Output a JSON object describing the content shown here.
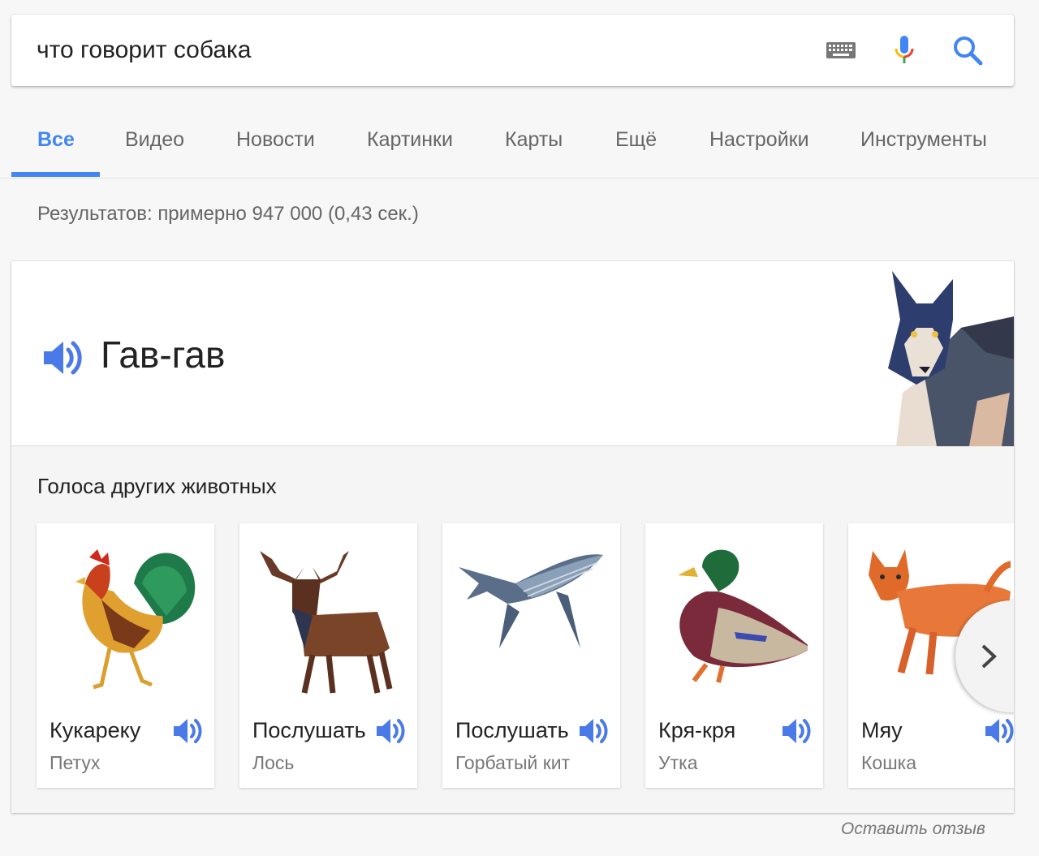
{
  "search": {
    "query": "что говорит собака",
    "icons": [
      "keyboard-icon",
      "mic-icon",
      "search-icon"
    ]
  },
  "tabs": [
    {
      "label": "Все",
      "active": true
    },
    {
      "label": "Видео"
    },
    {
      "label": "Новости"
    },
    {
      "label": "Картинки"
    },
    {
      "label": "Карты"
    },
    {
      "label": "Ещё"
    },
    {
      "label": "Настройки"
    },
    {
      "label": "Инструменты"
    }
  ],
  "stats": "Результатов: примерно 947 000 (0,43 сек.)",
  "answer": {
    "sound": "Гав-гав",
    "animal_icon": "dog-illustration"
  },
  "other": {
    "title": "Голоса других животных",
    "animals": [
      {
        "sound": "Кукареку",
        "name": "Петух"
      },
      {
        "sound": "Послушать",
        "name": "Лось"
      },
      {
        "sound": "Послушать",
        "name": "Горбатый кит"
      },
      {
        "sound": "Кря-кря",
        "name": "Утка"
      },
      {
        "sound": "Мяу",
        "name": "Кошка"
      }
    ]
  },
  "feedback": "Оставить отзыв",
  "colors": {
    "accent": "#4285f4",
    "speaker": "#4a7ae8"
  }
}
